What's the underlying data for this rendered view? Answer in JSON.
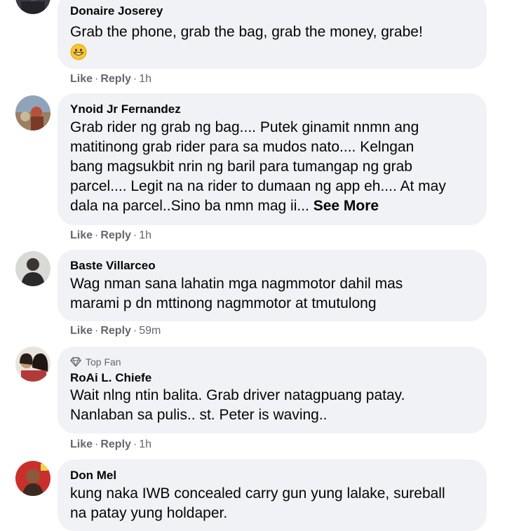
{
  "comments": [
    {
      "author": "Donaire Joserey",
      "lines": [
        "Grab the phone, grab the bag, grab the money, grabe!"
      ],
      "emoji": "grinning-face-icon",
      "actions": {
        "like": "Like",
        "reply": "Reply",
        "time": "1h"
      }
    },
    {
      "author": "Ynoid Jr Fernandez",
      "lines": [
        "Grab rider ng grab ng bag.... Putek ginamit nnmn ang",
        "matitinong grab rider para sa mudos nato.... Kelngan",
        "bang magsukbit nrin ng baril para tumangap ng grab",
        "parcel.... Legit na na rider to dumaan ng app eh.... At may",
        "dala na parcel..Sino ba nmn mag ii..."
      ],
      "see_more": "See More",
      "actions": {
        "like": "Like",
        "reply": "Reply",
        "time": "1h"
      }
    },
    {
      "author": "Baste Villarceo",
      "lines": [
        "Wag nman sana lahatin mga nagmmotor dahil mas",
        "marami p dn mttinong nagmmotor at tmutulong"
      ],
      "actions": {
        "like": "Like",
        "reply": "Reply",
        "time": "59m"
      }
    },
    {
      "badge": "Top Fan",
      "author": "RoAi L. Chiefe",
      "lines": [
        "Wait nlng ntin balita. Grab driver natagpuang patay.",
        "Nanlaban sa pulis.. st. Peter is waving.."
      ],
      "actions": {
        "like": "Like",
        "reply": "Reply",
        "time": "1h"
      }
    },
    {
      "author": "Don Mel",
      "lines": [
        "kung naka IWB concealed carry gun yung lalake, sureball",
        "na patay yung holdaper."
      ]
    }
  ],
  "separator": "·",
  "colors": {
    "bubble": "#f0f2f5",
    "text": "#050505",
    "meta": "#65676b"
  }
}
